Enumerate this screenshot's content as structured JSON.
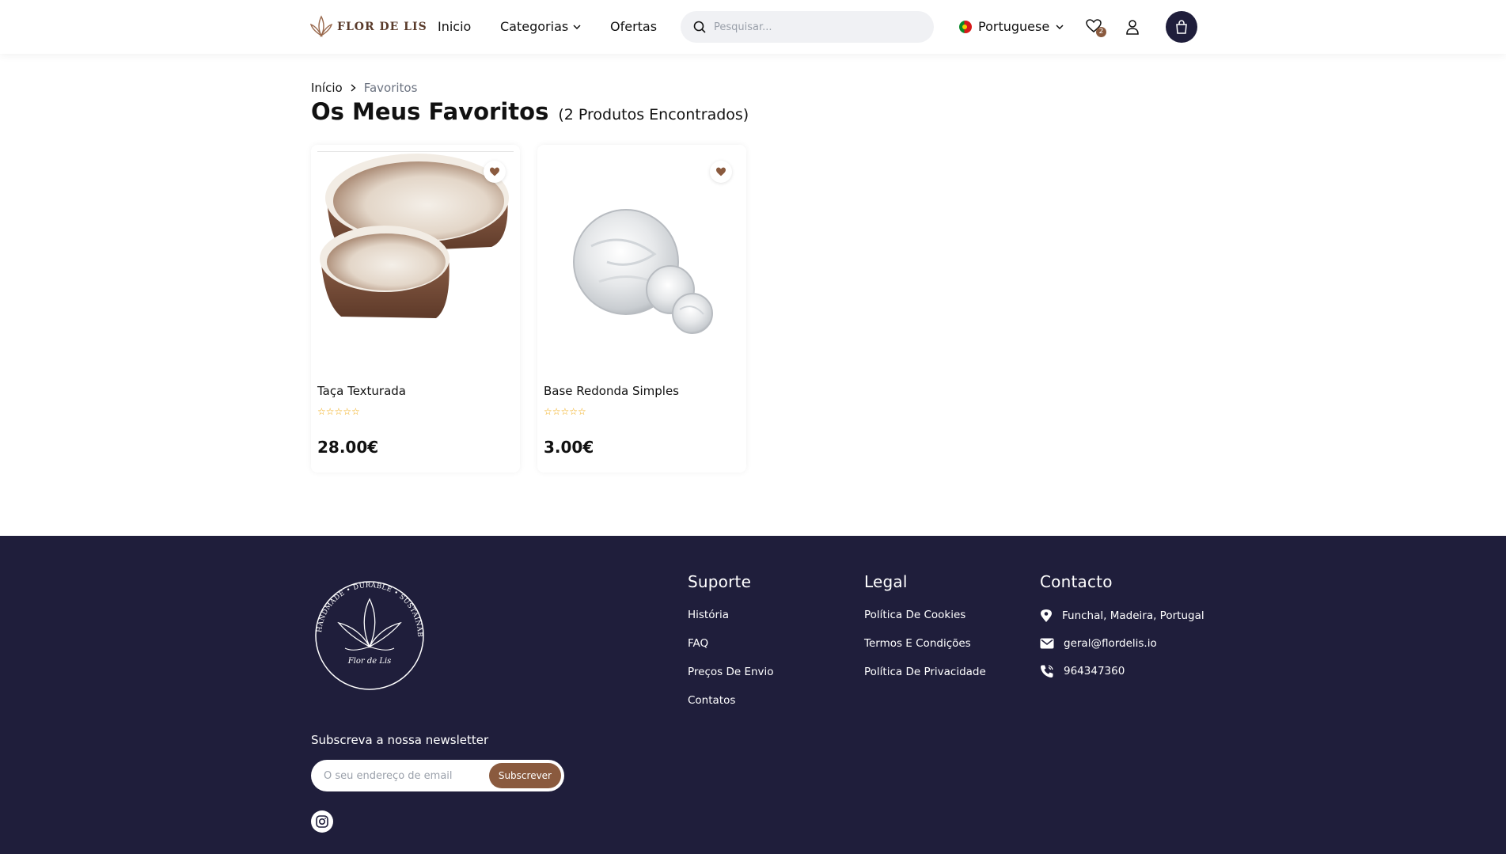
{
  "header": {
    "logo_text": "FLOR DE LIS",
    "nav": {
      "home": "Inicio",
      "categories": "Categorias",
      "offers": "Ofertas"
    },
    "search_placeholder": "Pesquisar...",
    "language": "Portuguese",
    "wishlist_count": "2",
    "icons": [
      "search-icon",
      "chevron-down-icon",
      "heart-icon",
      "user-icon",
      "shopping-bag-icon"
    ]
  },
  "breadcrumb": {
    "home": "Início",
    "current": "Favoritos"
  },
  "page": {
    "title": "Os Meus Favoritos",
    "count": "(2 Produtos Encontrados)"
  },
  "products": [
    {
      "name": "Taça Texturada",
      "price": "28.00€",
      "rating": 0,
      "stars": "☆☆☆☆☆"
    },
    {
      "name": "Base Redonda Simples",
      "price": "3.00€",
      "rating": 0,
      "stars": "☆☆☆☆☆"
    }
  ],
  "footer": {
    "support": {
      "heading": "Suporte",
      "links": [
        "História",
        "FAQ",
        "Preços De Envio",
        "Contatos"
      ]
    },
    "legal": {
      "heading": "Legal",
      "links": [
        "Política De Cookies",
        "Termos E Condições",
        "Política De Privacidade"
      ]
    },
    "contact": {
      "heading": "Contacto",
      "address": "Funchal, Madeira, Portugal",
      "email": "geral@flordelis.io",
      "phone": "964347360"
    },
    "newsletter": {
      "label": "Subscreva a nossa newsletter",
      "placeholder": "O seu endereço de email",
      "button": "Subscrever"
    },
    "logo_ring_text": "HANDMADE • DURABLE • SUSTAINABLE • ECO",
    "logo_script": "Flor de Lis"
  },
  "colors": {
    "navy": "#1f1e3b",
    "brown_accent": "#8a5a3e",
    "star": "#f0a400"
  }
}
